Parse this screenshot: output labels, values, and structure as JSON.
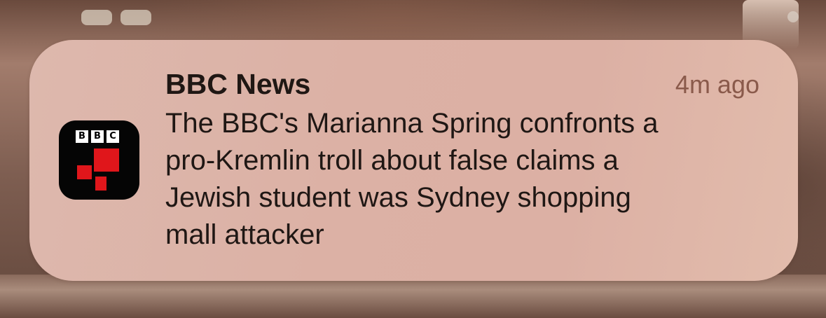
{
  "notification": {
    "app_name": "BBC News",
    "timestamp": "4m ago",
    "message": "The BBC's Marianna Spring confronts a\npro-Kremlin troll about false claims a\nJewish student was Sydney shopping\nmall attacker",
    "icon": {
      "name": "bbc-news-app-icon",
      "letters": [
        "B",
        "B",
        "C"
      ],
      "colors": {
        "background": "#050505",
        "accent": "#e0161b",
        "letter_block": "#ffffff"
      }
    }
  },
  "colors": {
    "card_background": "#dcb1a5",
    "title_text": "#1f1714",
    "timestamp_text": "#8a5a4b"
  }
}
